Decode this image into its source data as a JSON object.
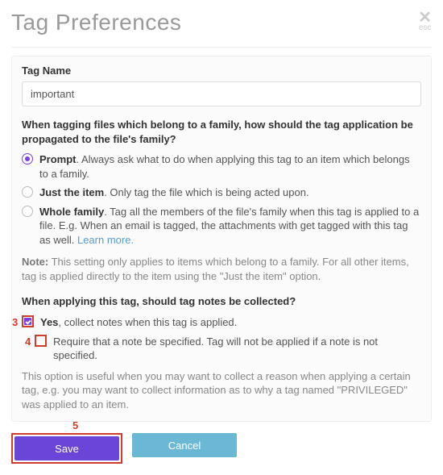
{
  "header": {
    "title": "Tag Preferences",
    "esc_label": "esc"
  },
  "tagName": {
    "label": "Tag Name",
    "value": "important"
  },
  "propagation": {
    "question": "When tagging files which belong to a family, how should the tag application be propagated to the file's family?",
    "options": {
      "prompt": {
        "title": "Prompt",
        "desc": ". Always ask what to do when applying this tag to an item which belongs to a family."
      },
      "just": {
        "title": "Just the item",
        "desc": ". Only tag the file which is being acted upon."
      },
      "whole": {
        "title": "Whole family",
        "desc": ". Tag all the members of the file's family when this tag is applied to a file. E.g. When an email is tagged, the attachments with get tagged with this tag as well. ",
        "learn": "Learn more."
      }
    },
    "note_label": "Note:",
    "note_text": " This setting only applies to items which belong to a family. For all other items, tag is applied directly to the item using the \"Just the item\" option."
  },
  "notes": {
    "question": "When applying this tag, should tag notes be collected?",
    "yes_title": "Yes",
    "yes_desc": ", collect notes when this tag is applied.",
    "require_desc": "Require that a note be specified. Tag will not be applied if a note is not specified.",
    "help": "This option is useful when you may want to collect a reason when applying a certain tag, e.g. you may want to collect information as to why a tag named \"PRIVILEGED\" was applied to an item."
  },
  "annotations": {
    "a3": "3",
    "a4": "4",
    "a5": "5"
  },
  "buttons": {
    "save": "Save",
    "cancel": "Cancel"
  }
}
